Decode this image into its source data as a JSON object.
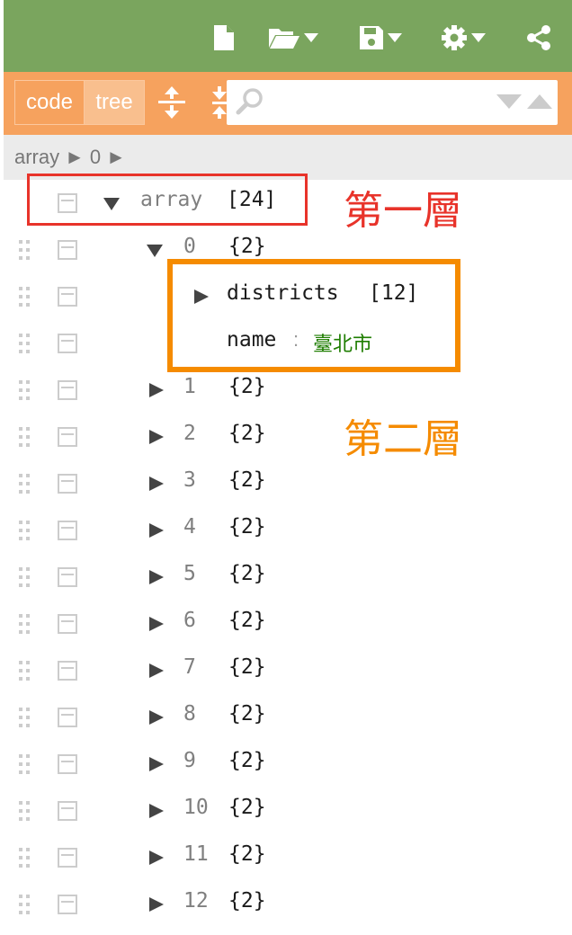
{
  "menubar": {
    "icons": [
      "new-document-icon",
      "open-folder-icon",
      "save-icon",
      "settings-gear-icon",
      "share-icon"
    ],
    "bg_color": "#7aa55e"
  },
  "toolbar": {
    "mode_code_label": "code",
    "mode_tree_label": "tree",
    "bg_color": "#f6a25e",
    "search": {
      "value": "",
      "placeholder": ""
    }
  },
  "navbar": {
    "path": [
      "array",
      "►",
      "0",
      "►"
    ]
  },
  "tree": {
    "root": {
      "field": "array",
      "info": "[24]"
    },
    "item0": {
      "field": "0",
      "info": "{2}"
    },
    "districts": {
      "field": "districts",
      "info": "[12]"
    },
    "name": {
      "field": "name",
      "separator": ":",
      "value": "臺北市"
    },
    "items": [
      {
        "field": "1",
        "info": "{2}"
      },
      {
        "field": "2",
        "info": "{2}"
      },
      {
        "field": "3",
        "info": "{2}"
      },
      {
        "field": "4",
        "info": "{2}"
      },
      {
        "field": "5",
        "info": "{2}"
      },
      {
        "field": "6",
        "info": "{2}"
      },
      {
        "field": "7",
        "info": "{2}"
      },
      {
        "field": "8",
        "info": "{2}"
      },
      {
        "field": "9",
        "info": "{2}"
      },
      {
        "field": "10",
        "info": "{2}"
      },
      {
        "field": "11",
        "info": "{2}"
      },
      {
        "field": "12",
        "info": "{2}"
      }
    ]
  },
  "annotations": {
    "level1_label": "第一層",
    "level2_label": "第二層",
    "level1_color": "#e8332a",
    "level2_color": "#f58b00"
  }
}
